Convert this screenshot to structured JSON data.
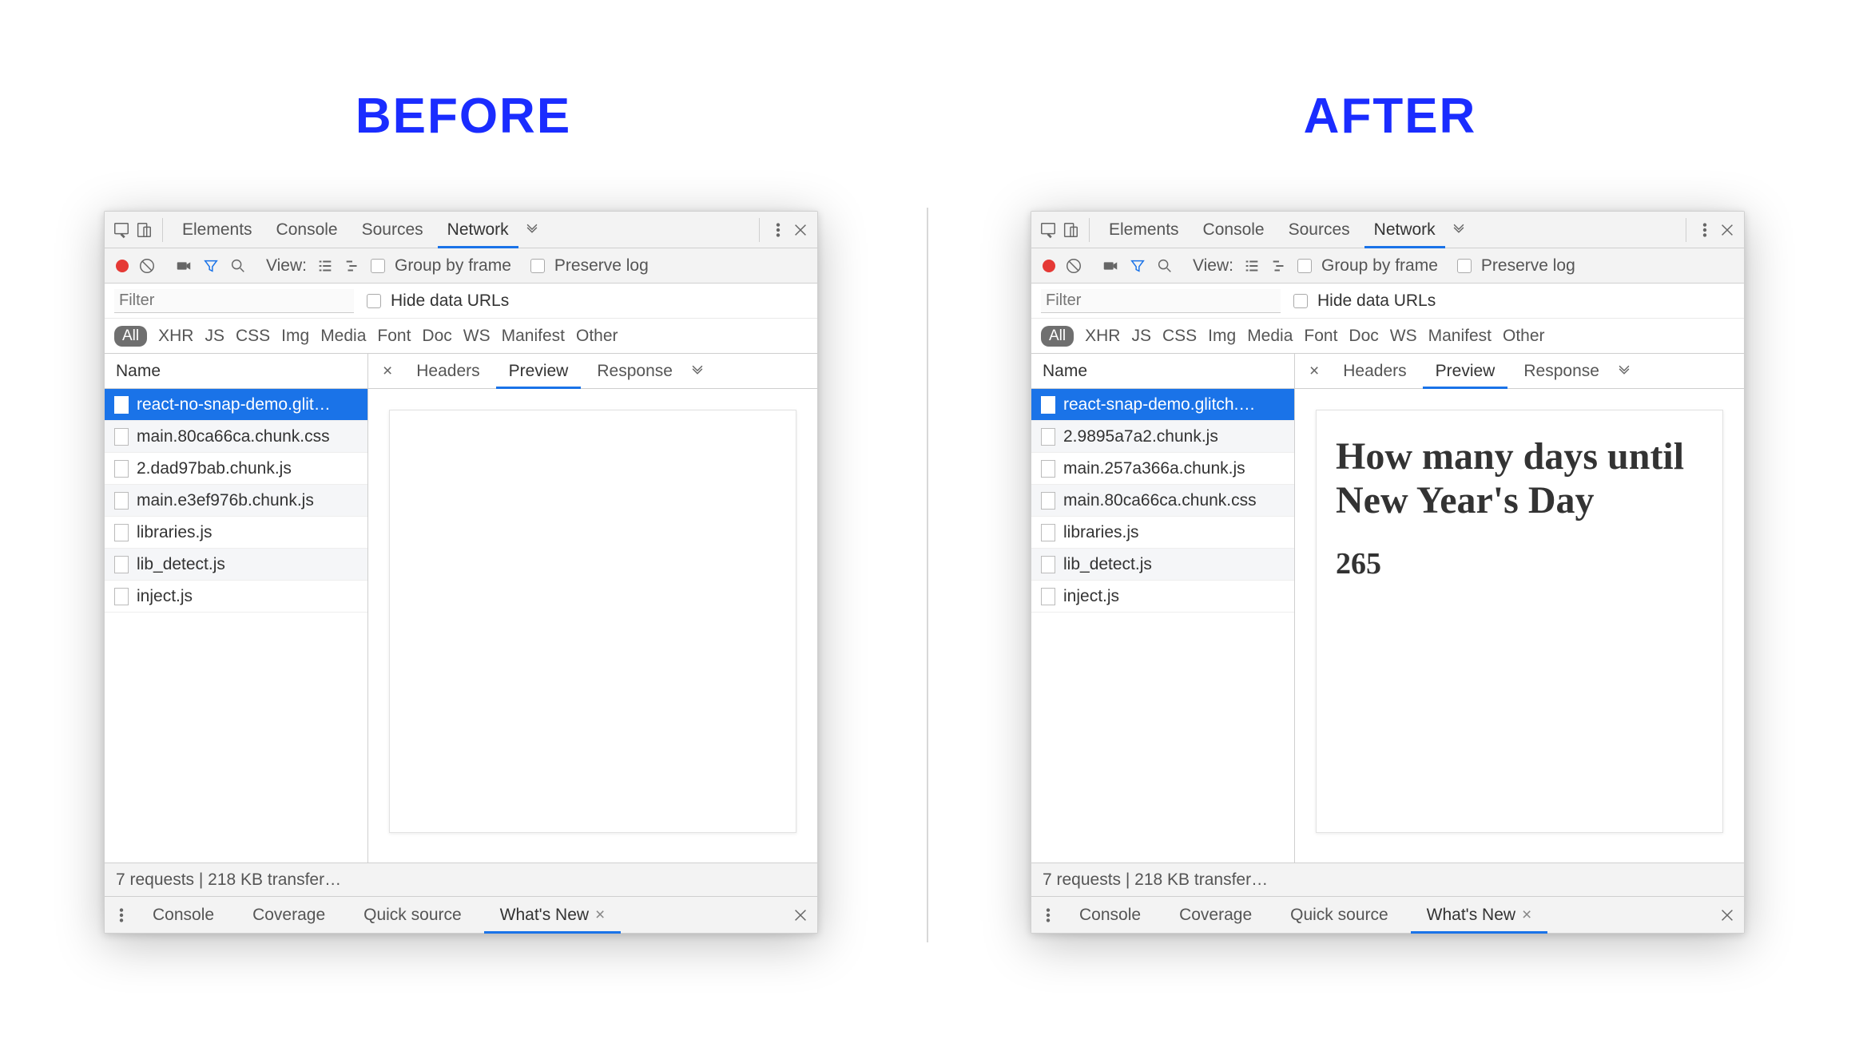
{
  "headings": {
    "before": "BEFORE",
    "after": "AFTER"
  },
  "devtools": {
    "main_tabs": {
      "elements": "Elements",
      "console": "Console",
      "sources": "Sources",
      "network": "Network"
    },
    "toolbar": {
      "view_label": "View:",
      "group_by_frame": "Group by frame",
      "preserve_log": "Preserve log"
    },
    "filter": {
      "placeholder": "Filter",
      "hide_data_urls": "Hide data URLs"
    },
    "type_filters": {
      "all": "All",
      "xhr": "XHR",
      "js": "JS",
      "css": "CSS",
      "img": "Img",
      "media": "Media",
      "font": "Font",
      "doc": "Doc",
      "ws": "WS",
      "manifest": "Manifest",
      "other": "Other"
    },
    "columns": {
      "name": "Name"
    },
    "detail_tabs": {
      "headers": "Headers",
      "preview": "Preview",
      "response": "Response"
    },
    "status": "7 requests | 218 KB transfer…",
    "drawer_tabs": {
      "console": "Console",
      "coverage": "Coverage",
      "quick_source": "Quick source",
      "whats_new": "What's New"
    }
  },
  "before": {
    "requests": [
      "react-no-snap-demo.glit…",
      "main.80ca66ca.chunk.css",
      "2.dad97bab.chunk.js",
      "main.e3ef976b.chunk.js",
      "libraries.js",
      "lib_detect.js",
      "inject.js"
    ],
    "preview": {
      "title": "",
      "value": ""
    }
  },
  "after": {
    "requests": [
      "react-snap-demo.glitch.…",
      "2.9895a7a2.chunk.js",
      "main.257a366a.chunk.js",
      "main.80ca66ca.chunk.css",
      "libraries.js",
      "lib_detect.js",
      "inject.js"
    ],
    "preview": {
      "title": "How many days until New Year's Day",
      "value": "265"
    }
  }
}
